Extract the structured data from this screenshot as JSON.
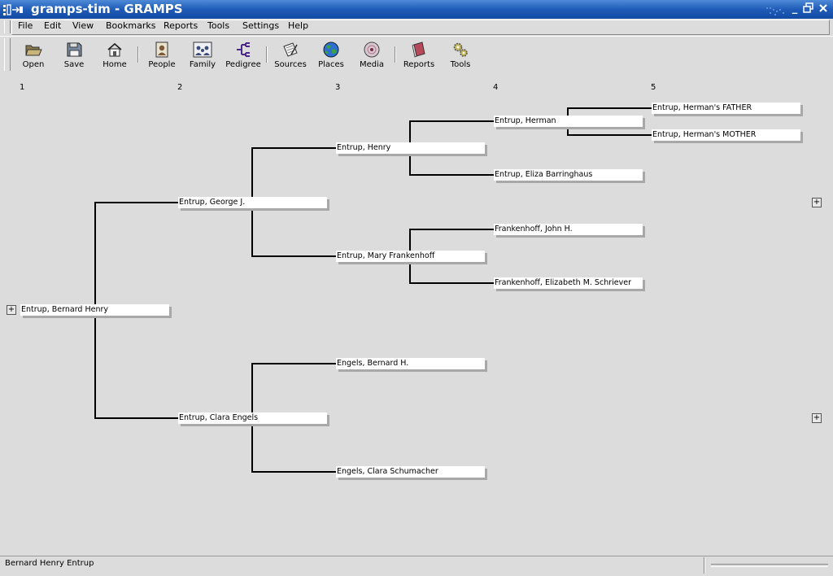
{
  "window": {
    "title": "gramps-tim - GRAMPS"
  },
  "menu": [
    "File",
    "Edit",
    "View",
    "Bookmarks",
    "Reports",
    "Tools",
    "Settings",
    "Help"
  ],
  "toolbar": {
    "open": "Open",
    "save": "Save",
    "home": "Home",
    "people": "People",
    "family": "Family",
    "pedigree": "Pedigree",
    "sources": "Sources",
    "places": "Places",
    "media": "Media",
    "reports": "Reports",
    "tools": "Tools"
  },
  "pedigree": {
    "generations": [
      "1",
      "2",
      "3",
      "4",
      "5"
    ],
    "people": [
      "Entrup, Bernard Henry",
      "Entrup, George J.",
      "Entrup, Clara Engels",
      "Entrup, Henry",
      "Entrup, Mary Frankenhoff",
      "Engels, Bernard H.",
      "Engels, Clara Schumacher",
      "Entrup, Herman",
      "Entrup, Eliza Barringhaus",
      "Frankenhoff, John H.",
      "Frankenhoff, Elizabeth M. Schriever",
      "Entrup, Herman's FATHER",
      "Entrup, Herman's MOTHER"
    ]
  },
  "status": {
    "text": "Bernard Henry Entrup"
  }
}
